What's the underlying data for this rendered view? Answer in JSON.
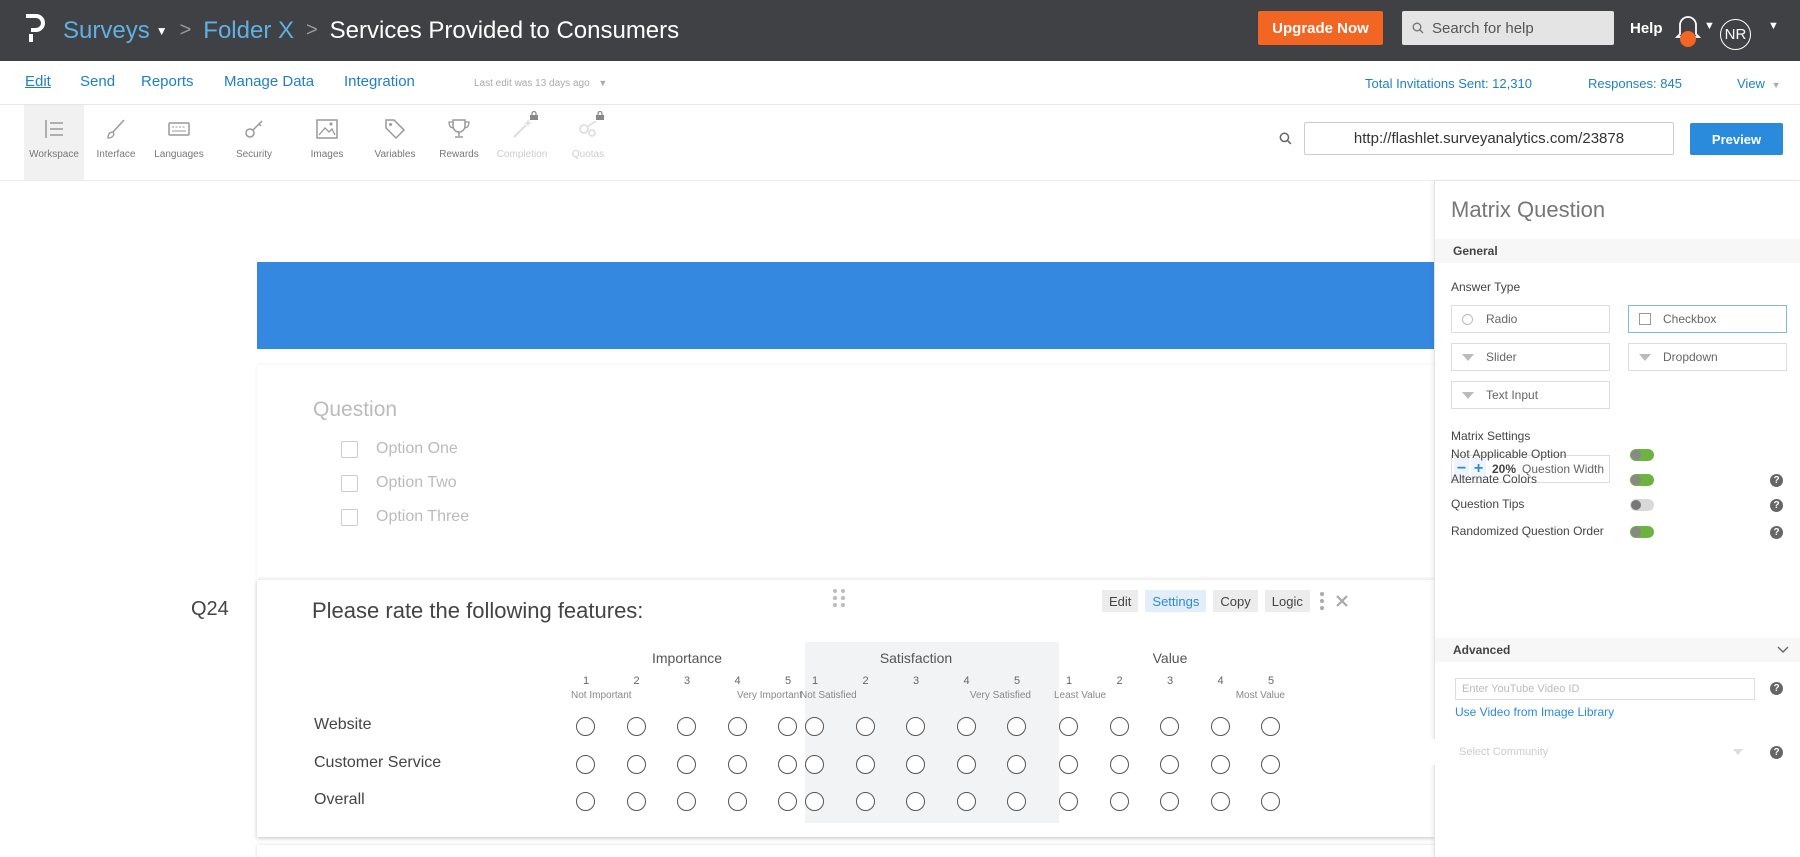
{
  "topbar": {
    "breadcrumb": {
      "surveys": "Surveys",
      "folder": "Folder X",
      "current": "Services Provided to Consumers"
    },
    "upgrade_label": "Upgrade Now",
    "search_placeholder": "Search for help",
    "help_label": "Help",
    "avatar_initials": "NR",
    "accent_color": "#f26522"
  },
  "menu": {
    "items": [
      "Edit",
      "Send",
      "Reports",
      "Manage Data",
      "Integration"
    ],
    "last_edit": "Last edit was 13 days ago",
    "total_invitations": "Total Invitations Sent: 12,310",
    "responses": "Responses:  845",
    "view": "View"
  },
  "tools": {
    "items": [
      {
        "label": "Workspace",
        "icon": "workspace-icon"
      },
      {
        "label": "Interface",
        "icon": "brush-icon"
      },
      {
        "label": "Languages",
        "icon": "keyboard-icon"
      },
      {
        "label": "Security",
        "icon": "key-icon"
      },
      {
        "label": "Images",
        "icon": "image-icon"
      },
      {
        "label": "Variables",
        "icon": "tag-icon"
      },
      {
        "label": "Rewards",
        "icon": "trophy-icon"
      },
      {
        "label": "Completion",
        "icon": "magic-wand-icon"
      },
      {
        "label": "Quotas",
        "icon": "quota-icon"
      }
    ],
    "url": "http://flashlet.surveyanalytics.com/23878",
    "preview_label": "Preview"
  },
  "canvas": {
    "banner_color": "#3588e0",
    "ghost": {
      "title": "Question",
      "options": [
        "Option One",
        "Option Two",
        "Option Three"
      ]
    },
    "question": {
      "number": "Q24",
      "title": "Please rate the following features:",
      "actions": [
        "Edit",
        "Settings",
        "Copy",
        "Logic"
      ],
      "groups": [
        {
          "name": "Importance",
          "low": "Not Important",
          "high": "Very Important"
        },
        {
          "name": "Satisfaction",
          "low": "Not Satisfied",
          "high": "Very Satisfied"
        },
        {
          "name": "Value",
          "low": "Least Value",
          "high": "Most Value"
        }
      ],
      "scale": [
        "1",
        "2",
        "3",
        "4",
        "5"
      ],
      "rows": [
        "Website",
        "Customer Service",
        "Overall"
      ]
    }
  },
  "panel": {
    "title": "Matrix Question",
    "general": "General",
    "answer_type": "Answer Type",
    "types": {
      "radio": "Radio",
      "checkbox": "Checkbox",
      "slider": "Slider",
      "dropdown": "Dropdown",
      "text": "Text Input"
    },
    "matrix_settings": "Matrix Settings",
    "minus": "−",
    "plus": "+",
    "width_value": "20%",
    "width_label": "Question Width",
    "toggles": [
      {
        "label": "Not Applicable Option",
        "on": true,
        "help": false
      },
      {
        "label": "Alternate Colors",
        "on": true,
        "help": true
      },
      {
        "label": "Question Tips",
        "on": false,
        "help": true
      },
      {
        "label": "Randomized Question Order",
        "on": true,
        "help": true
      }
    ],
    "help_glyph": "?",
    "advanced": "Advanced",
    "youtube_placeholder": "Enter YouTube Video ID",
    "image_library": "Use Video from Image Library",
    "community_placeholder": "Select Community"
  }
}
